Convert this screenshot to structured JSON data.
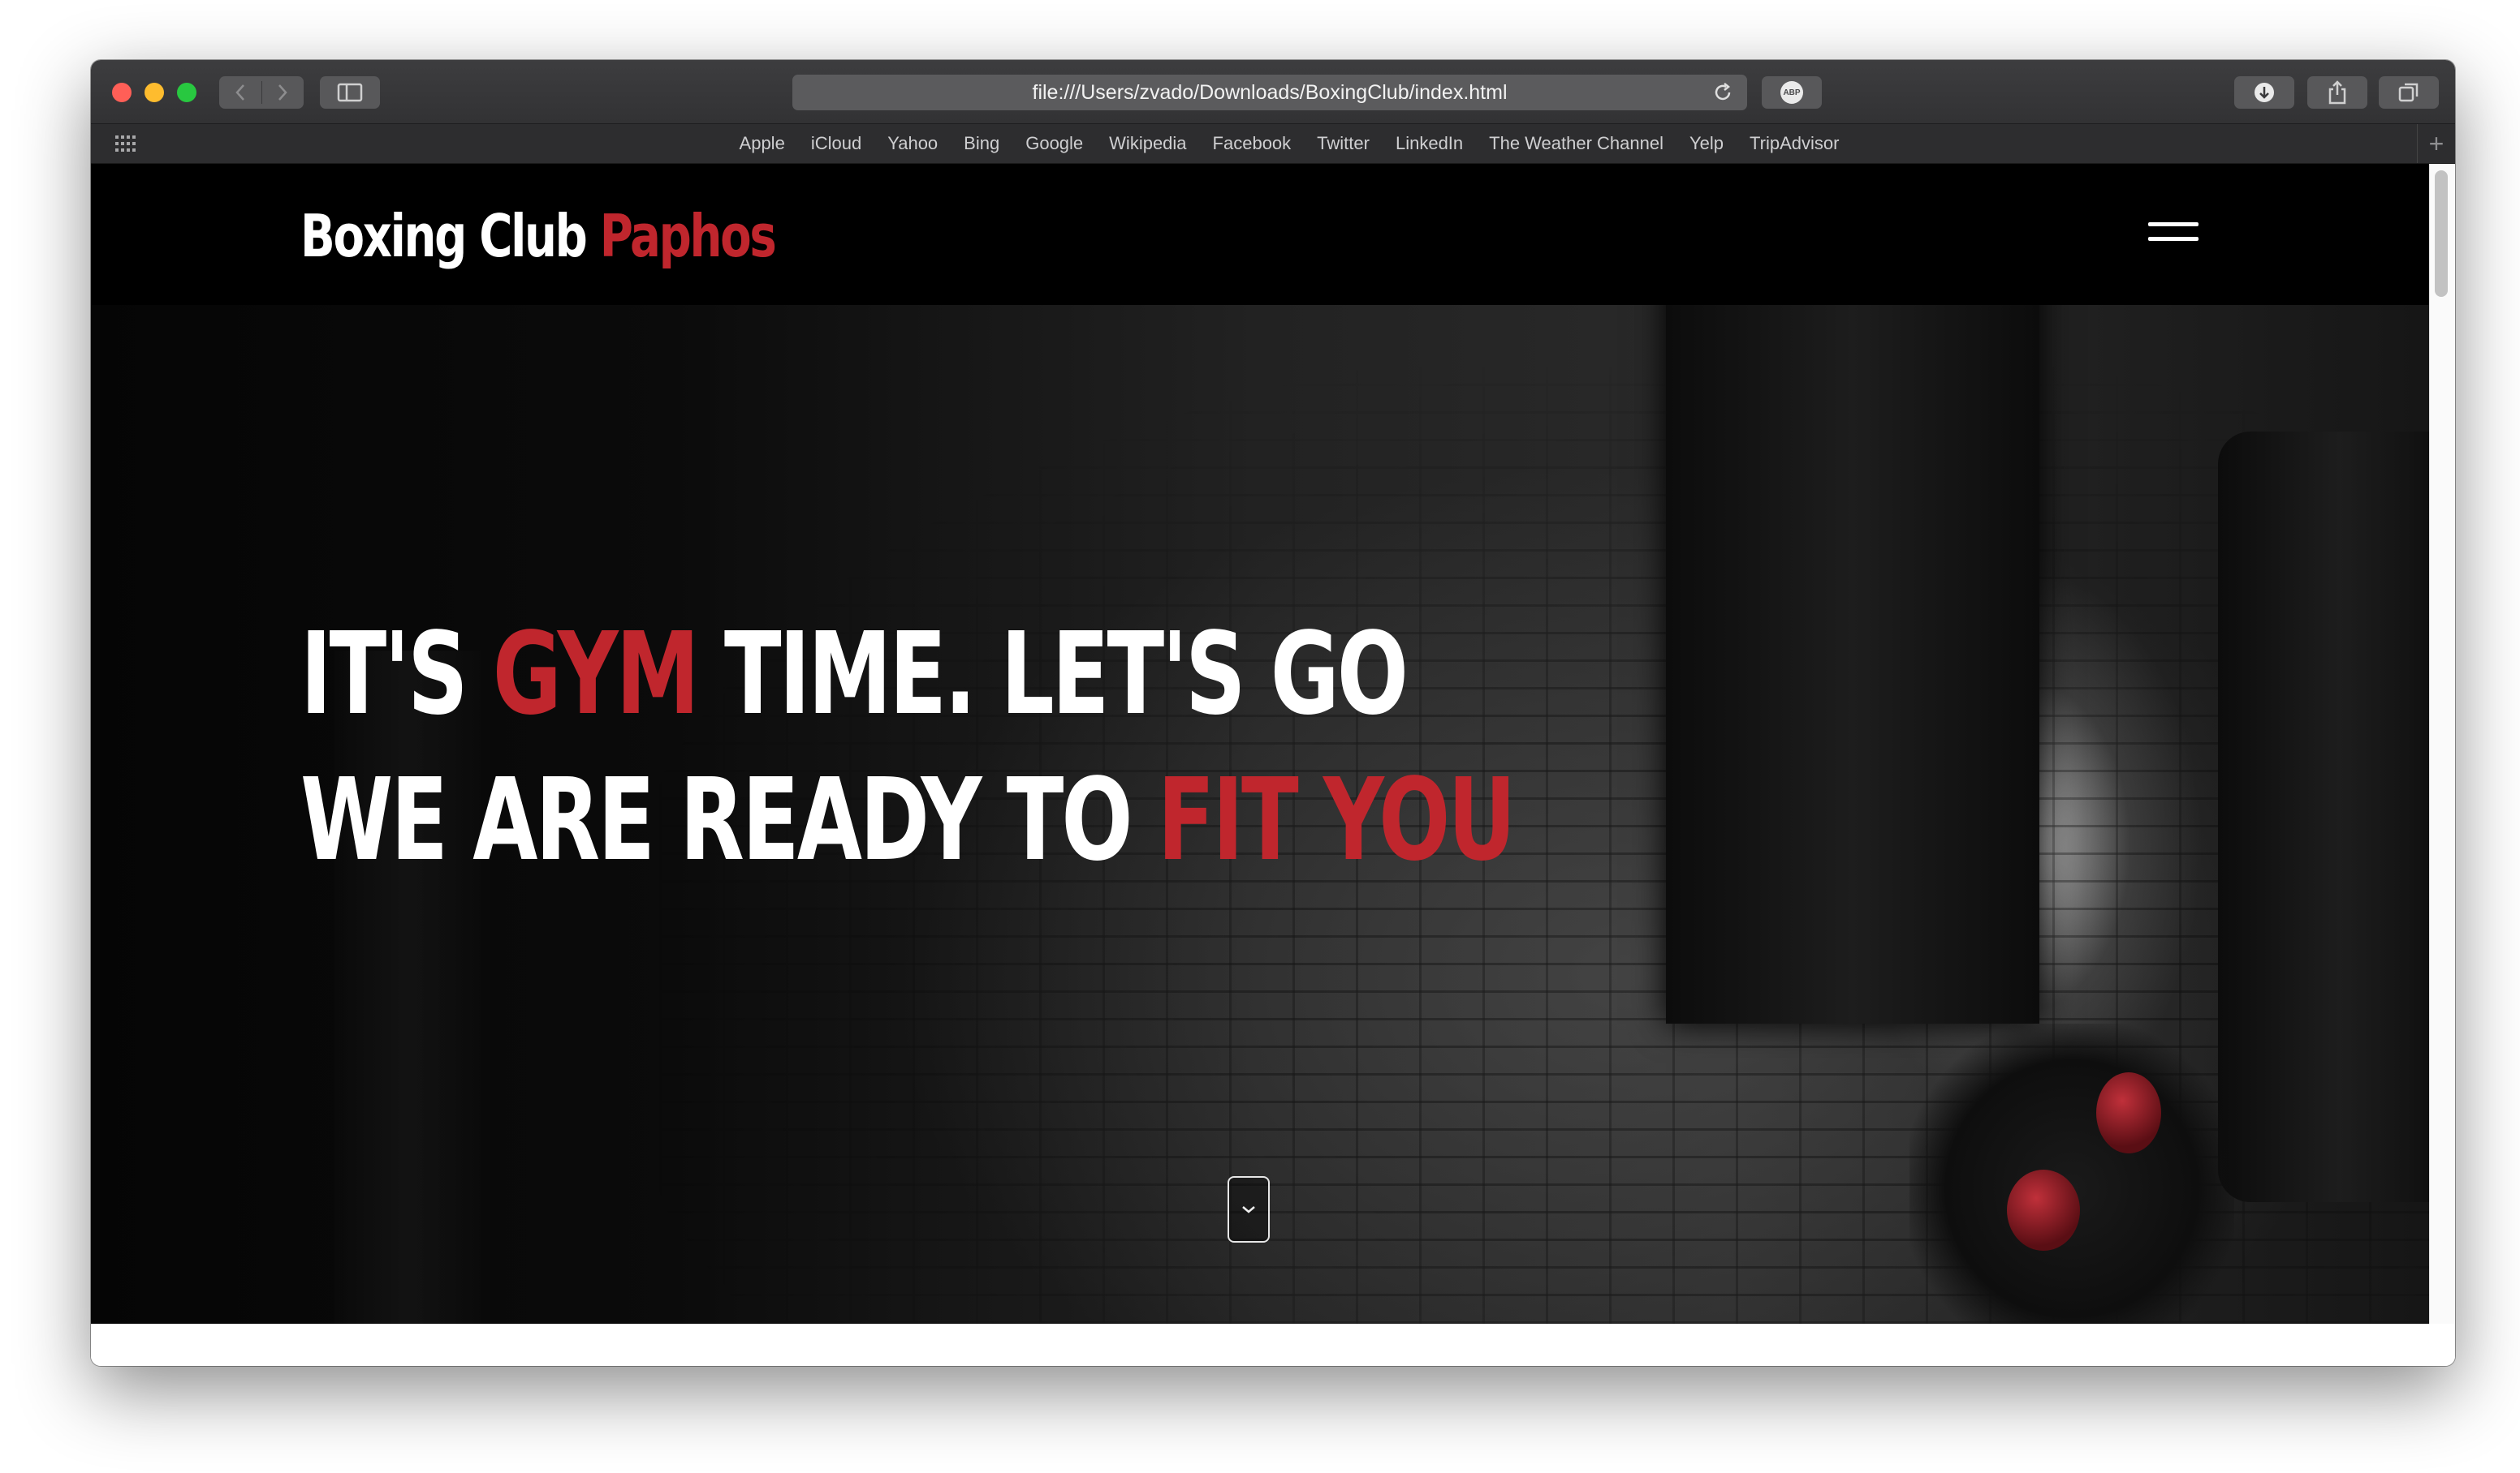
{
  "browser": {
    "url": "file:///Users/zvado/Downloads/BoxingClub/index.html",
    "abp_label": "ABP",
    "favorites": [
      "Apple",
      "iCloud",
      "Yahoo",
      "Bing",
      "Google",
      "Wikipedia",
      "Facebook",
      "Twitter",
      "LinkedIn",
      "The Weather Channel",
      "Yelp",
      "TripAdvisor"
    ],
    "new_tab_symbol": "+"
  },
  "site": {
    "brand_white": "Boxing Club",
    "brand_red": "Paphos",
    "accent_color": "#c0262d"
  },
  "hero": {
    "line1_a": "IT'S",
    "line1_red": "GYM",
    "line1_b": "TIME. LET'S GO",
    "line2_a": "WE ARE READY TO",
    "line2_red": "FIT YOU"
  },
  "icons": {
    "menu": "hamburger-icon",
    "scroll": "chevron-down-icon"
  }
}
